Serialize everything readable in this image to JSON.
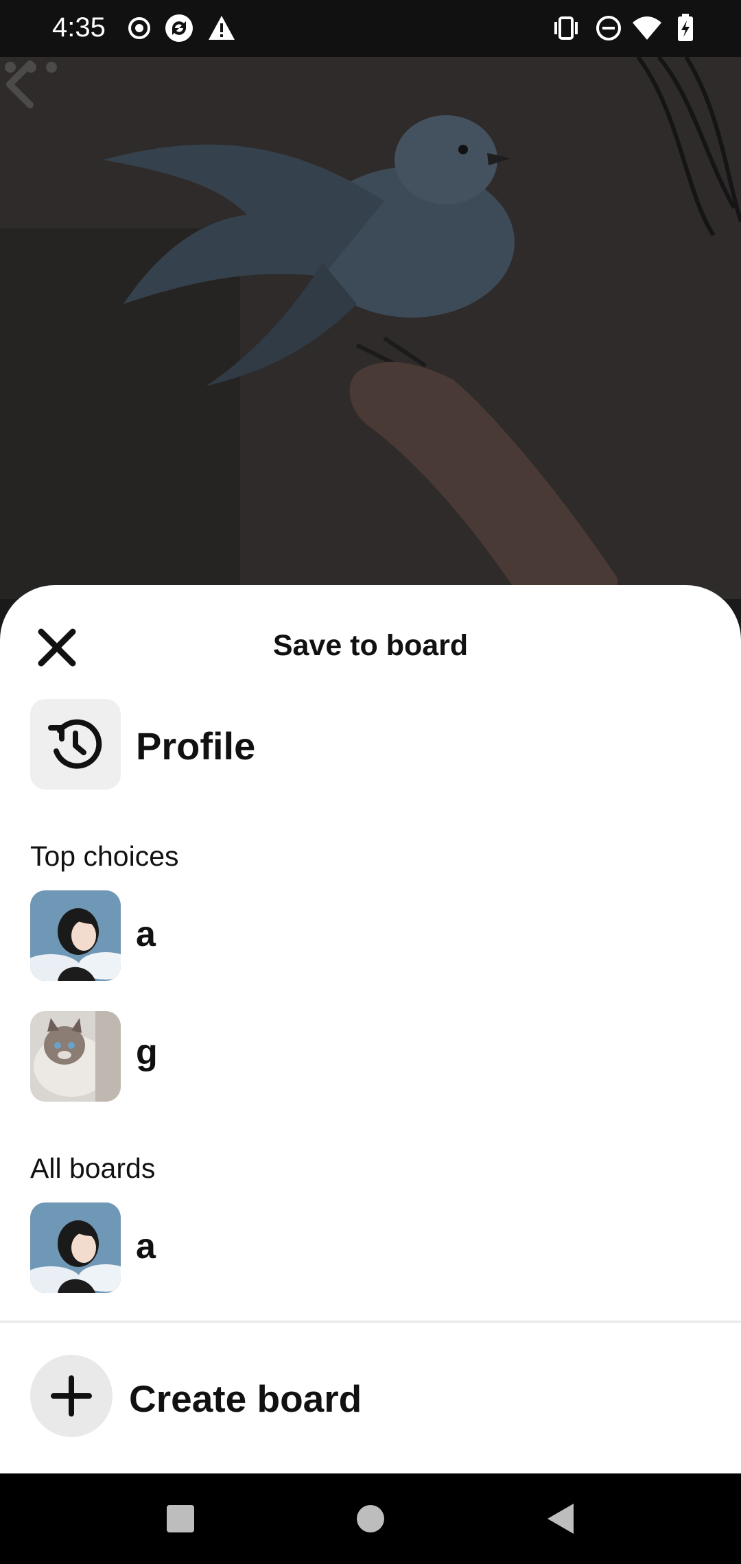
{
  "status_bar": {
    "time": "4:35",
    "left_icons": [
      "record-icon",
      "sync-icon",
      "warning-icon"
    ],
    "right_icons": [
      "vibrate-icon",
      "do-not-disturb-icon",
      "wifi-icon",
      "battery-charging-icon"
    ]
  },
  "background_pin": {
    "top_icons": [
      "chevron-left-icon",
      "more-horizontal-icon"
    ]
  },
  "sheet": {
    "title": "Save to board",
    "close_icon": "close-icon",
    "profile": {
      "label": "Profile",
      "icon": "history-icon"
    },
    "top_choices": {
      "heading": "Top choices",
      "boards": [
        {
          "name": "a",
          "thumbnail": "anime-girl-sky"
        },
        {
          "name": "g",
          "thumbnail": "ragdoll-cat"
        }
      ]
    },
    "all_boards": {
      "heading": "All boards",
      "boards": [
        {
          "name": "a",
          "thumbnail": "anime-girl-sky"
        }
      ]
    },
    "create_board": {
      "label": "Create board",
      "icon": "plus-icon"
    }
  },
  "nav_bar": {
    "buttons": [
      "recents-button",
      "home-button",
      "back-button"
    ]
  },
  "colors": {
    "sheet_background": "#ffffff",
    "tile_background": "#efefef",
    "text_primary": "#111111",
    "scrim": "#2c2a29"
  }
}
